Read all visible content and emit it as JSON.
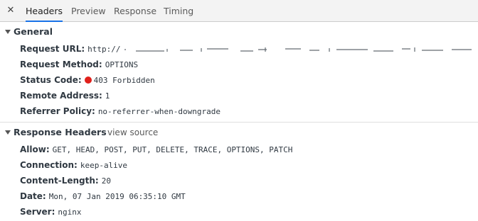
{
  "tabs": {
    "close_glyph": "✕",
    "items": [
      {
        "label": "Headers",
        "active": true
      },
      {
        "label": "Preview",
        "active": false
      },
      {
        "label": "Response",
        "active": false
      },
      {
        "label": "Timing",
        "active": false
      }
    ],
    "accent_color": "#1a73e8"
  },
  "general": {
    "title": "General",
    "request_url": {
      "key": "Request URL:",
      "value": "http://"
    },
    "request_method": {
      "key": "Request Method:",
      "value": "OPTIONS"
    },
    "status_code": {
      "key": "Status Code:",
      "value": "403 Forbidden",
      "status_color": "#e0201b"
    },
    "remote_address": {
      "key": "Remote Address:",
      "value": "1"
    },
    "referrer_policy": {
      "key": "Referrer Policy:",
      "value": "no-referrer-when-downgrade"
    }
  },
  "response_headers": {
    "title": "Response Headers",
    "view_source": "view source",
    "allow": {
      "key": "Allow:",
      "value": "GET, HEAD, POST, PUT, DELETE, TRACE, OPTIONS, PATCH"
    },
    "connection": {
      "key": "Connection:",
      "value": "keep-alive"
    },
    "content_length": {
      "key": "Content-Length:",
      "value": "20"
    },
    "date": {
      "key": "Date:",
      "value": "Mon, 07 Jan 2019 06:35:10 GMT"
    },
    "server": {
      "key": "Server:",
      "value": "nginx"
    }
  }
}
